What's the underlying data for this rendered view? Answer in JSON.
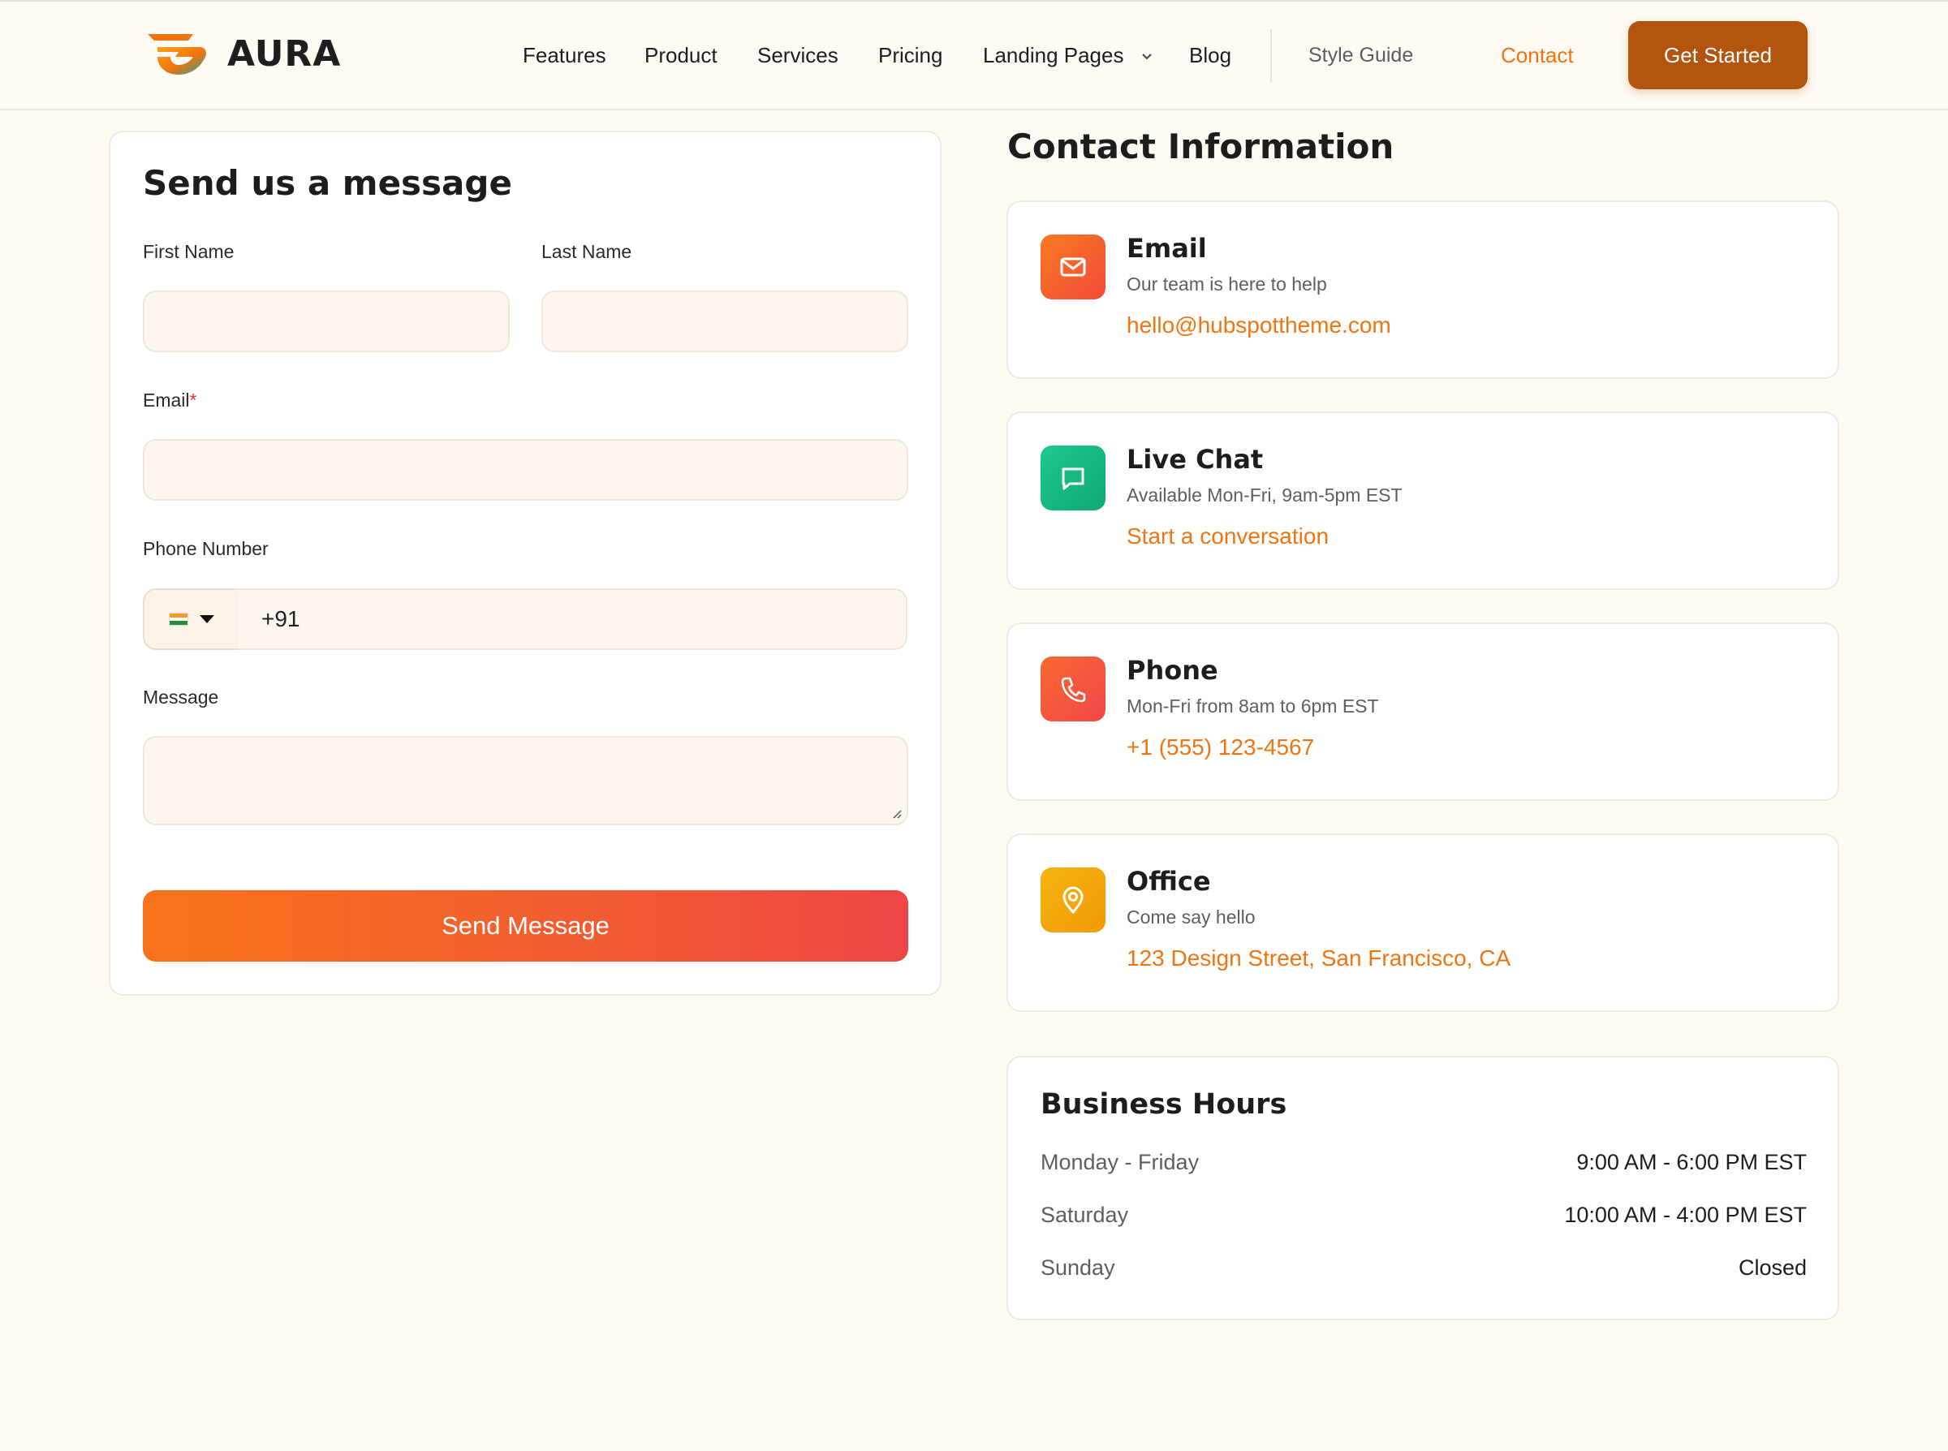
{
  "brand": {
    "name": "AURA"
  },
  "nav": {
    "items": [
      "Features",
      "Product",
      "Services",
      "Pricing",
      "Landing Pages",
      "Blog"
    ],
    "style_guide": "Style Guide",
    "contact": "Contact",
    "cta": "Get Started"
  },
  "form": {
    "title": "Send us a message",
    "first_name_label": "First Name",
    "last_name_label": "Last Name",
    "email_label": "Email",
    "required_mark": "*",
    "phone_label": "Phone Number",
    "phone_value": "+91",
    "message_label": "Message",
    "submit": "Send Message"
  },
  "contact": {
    "title": "Contact Information",
    "cards": [
      {
        "title": "Email",
        "subtitle": "Our team is here to help",
        "link": "hello@hubspottheme.com",
        "icon": "mail-icon",
        "color": "#f7592e"
      },
      {
        "title": "Live Chat",
        "subtitle": "Available Mon-Fri, 9am-5pm EST",
        "link": "Start a conversation",
        "icon": "chat-icon",
        "color": "#15b87e"
      },
      {
        "title": "Phone",
        "subtitle": "Mon-Fri from 8am to 6pm EST",
        "link": "+1 (555) 123-4567",
        "icon": "phone-icon",
        "color": "#f55b3c"
      },
      {
        "title": "Office",
        "subtitle": "Come say hello",
        "link": "123 Design Street, San Francisco, CA",
        "icon": "map-pin-icon",
        "color": "#f2a507"
      }
    ]
  },
  "hours": {
    "title": "Business Hours",
    "rows": [
      {
        "day": "Monday - Friday",
        "time": "9:00 AM - 6:00 PM EST"
      },
      {
        "day": "Saturday",
        "time": "10:00 AM - 4:00 PM EST"
      },
      {
        "day": "Sunday",
        "time": "Closed"
      }
    ]
  },
  "colors": {
    "accent": "#f07410",
    "cta": "#b3540f",
    "background": "#fffaf3"
  }
}
